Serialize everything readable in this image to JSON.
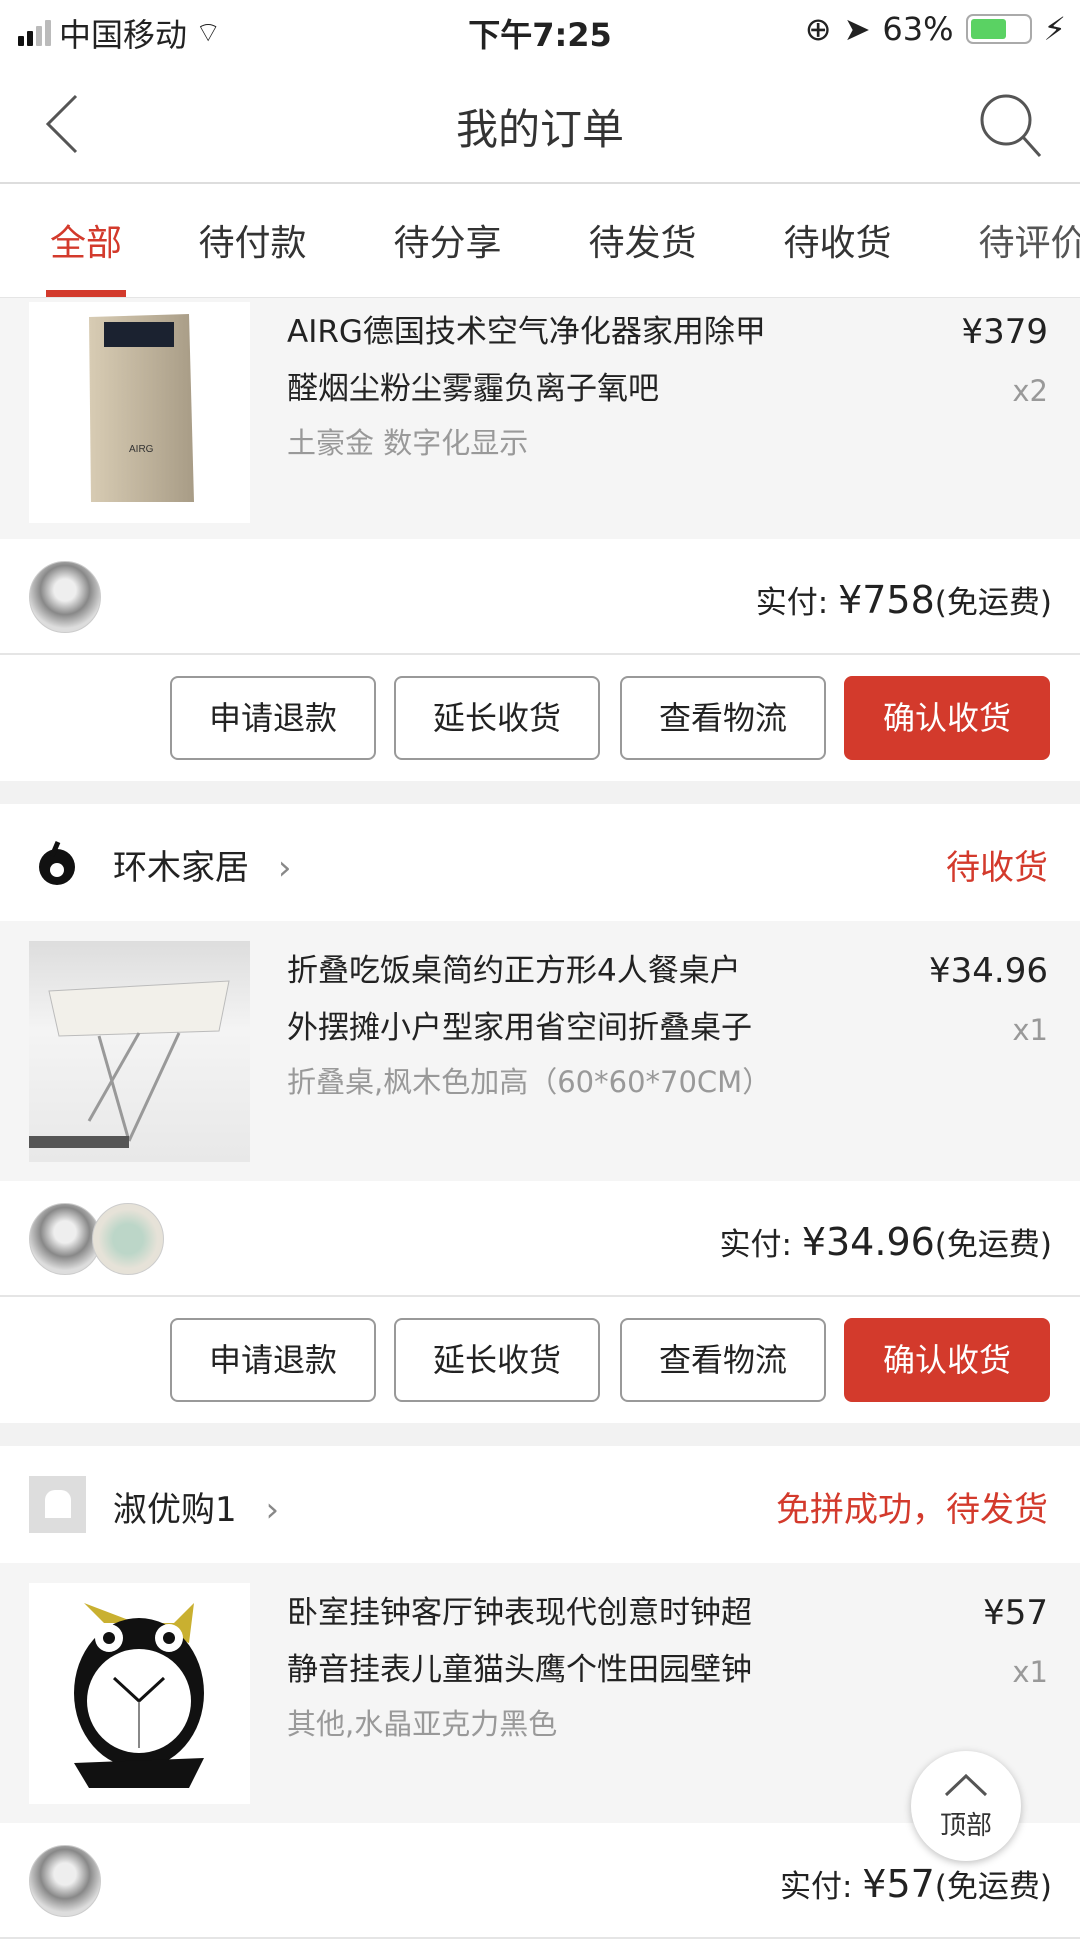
{
  "status_bar": {
    "carrier": "中国移动",
    "time": "下午7:25",
    "battery": "63%",
    "battery_level": 0.63
  },
  "header": {
    "title": "我的订单"
  },
  "tabs": [
    "全部",
    "待付款",
    "待分享",
    "待发货",
    "待收货",
    "待评价"
  ],
  "orders": [
    {
      "product": {
        "title_line1": "AIRG德国技术空气净化器家用除甲",
        "title_line2": "醛烟尘粉尘雾霾负离子氧吧",
        "spec": "土豪金   数字化显示",
        "price": "¥379",
        "qty": "x2",
        "image_text": "AIRG"
      },
      "pay_label": "实付: ",
      "pay_amount": "¥758",
      "pay_note": "(免运费)",
      "buttons": [
        "申请退款",
        "延长收货",
        "查看物流",
        "确认收货"
      ]
    },
    {
      "shop": "环木家居",
      "status": "待收货",
      "product": {
        "title_line1": "折叠吃饭桌简约正方形4人餐桌户",
        "title_line2": "外摆摊小户型家用省空间折叠桌子",
        "spec": "折叠桌,枫木色加高（60*60*70CM）",
        "price": "¥34.96",
        "qty": "x1"
      },
      "pay_label": "实付: ",
      "pay_amount": "¥34.96",
      "pay_note": "(免运费)",
      "buttons": [
        "申请退款",
        "延长收货",
        "查看物流",
        "确认收货"
      ]
    },
    {
      "shop": "淑优购1",
      "status": "免拼成功，待发货",
      "product": {
        "title_line1": "卧室挂钟客厅钟表现代创意时钟超",
        "title_line2": "静音挂表儿童猫头鹰个性田园壁钟",
        "spec": "其他,水晶亚克力黑色",
        "price": "¥57",
        "qty": "x1"
      },
      "pay_label": "实付: ",
      "pay_amount": "¥57",
      "pay_note": "(免运费)"
    }
  ],
  "back_to_top": "顶部",
  "colors": {
    "accent": "#d33a2c",
    "bg": "#f5f5f5"
  }
}
